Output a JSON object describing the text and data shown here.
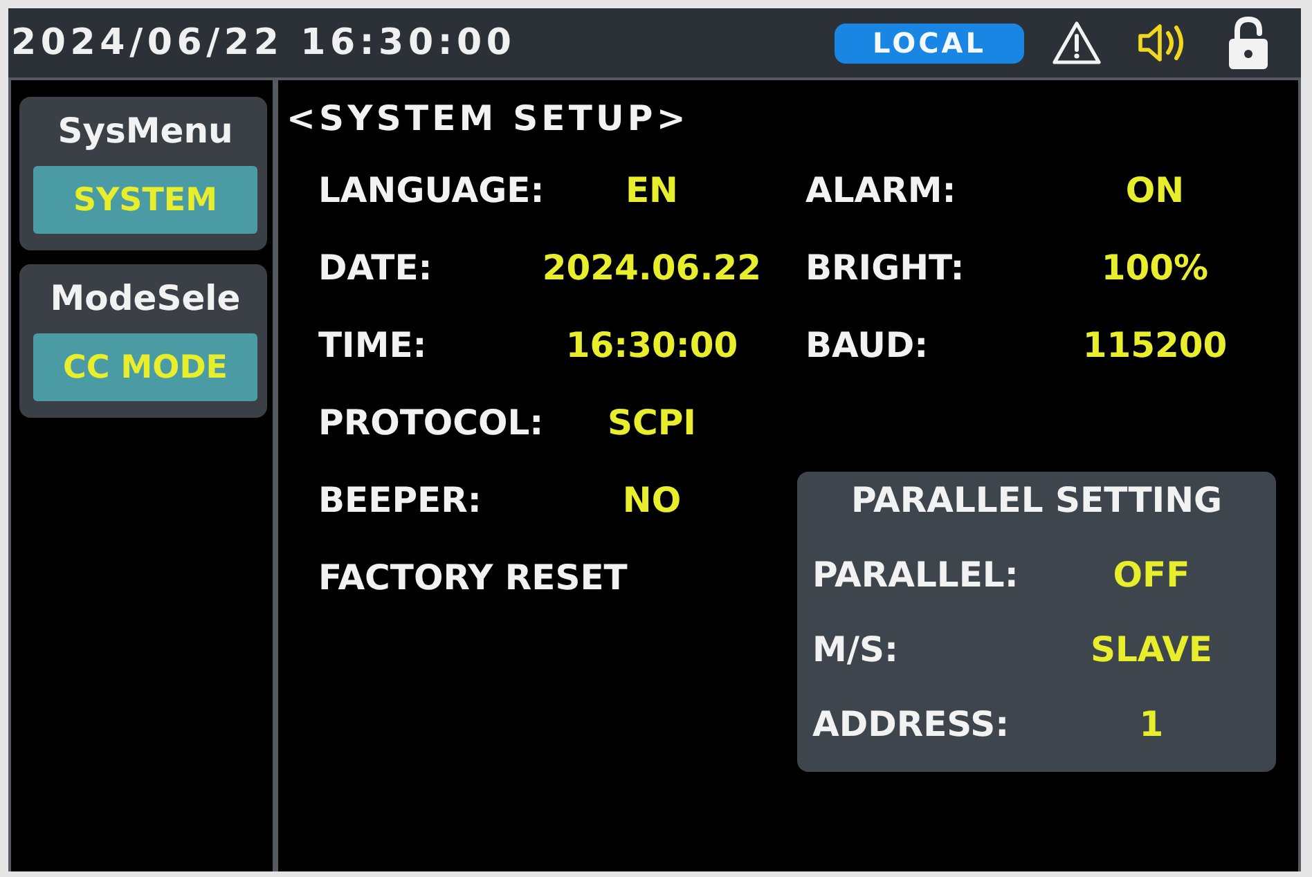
{
  "status_bar": {
    "datetime": "2024/06/22 16:30:00",
    "mode": "LOCAL"
  },
  "sidebar": {
    "groups": [
      {
        "title": "SysMenu",
        "items": [
          {
            "label": "SYSTEM",
            "selected": true
          }
        ]
      },
      {
        "title": "ModeSele",
        "items": [
          {
            "label": "CC MODE",
            "selected": true
          }
        ]
      }
    ]
  },
  "system_setup": {
    "title": "<SYSTEM SETUP>",
    "left_settings": [
      {
        "kind": "value",
        "label": "LANGUAGE:",
        "value": "EN"
      },
      {
        "kind": "value",
        "label": "DATE:",
        "value": "2024.06.22"
      },
      {
        "kind": "value",
        "label": "TIME:",
        "value": "16:30:00"
      },
      {
        "kind": "value",
        "label": "PROTOCOL:",
        "value": "SCPI"
      },
      {
        "kind": "value",
        "label": "BEEPER:",
        "value": "NO"
      },
      {
        "kind": "action",
        "label": "FACTORY RESET"
      }
    ],
    "right_settings": [
      {
        "label": "ALARM:",
        "value": "ON"
      },
      {
        "label": "BRIGHT:",
        "value": "100%"
      },
      {
        "label": "BAUD:",
        "value": "115200"
      }
    ],
    "parallel": {
      "title": "PARALLEL SETTING",
      "settings": [
        {
          "label": "PARALLEL:",
          "value": "OFF"
        },
        {
          "label": "M/S:",
          "value": "SLAVE"
        },
        {
          "label": "ADDRESS:",
          "value": "1"
        }
      ]
    }
  }
}
